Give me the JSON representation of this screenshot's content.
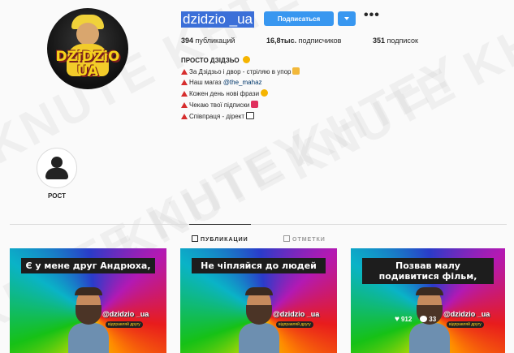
{
  "profile": {
    "username": "dzidzio _ua",
    "follow_label": "Подписаться",
    "more_label": "•••",
    "avatar_text_line1": "DZiDZiO",
    "avatar_text_line2": "UA",
    "stats": {
      "posts_count": "394",
      "posts_label": "публикаций",
      "followers_count": "16,8тыс.",
      "followers_label": "подписчиков",
      "following_count": "351",
      "following_label": "подписок"
    },
    "full_name": "ПРОСТО ДЗІДЗЬО",
    "bio_lines": [
      "За Дзідзьо і двор - стріляю в упор",
      "Наш магаз ",
      "Кожен день нові фрази",
      "Чекаю твої підписки",
      "Співпраця - дірект"
    ],
    "bio_link": "@the_mahaz"
  },
  "highlights": [
    {
      "label": "РОСТ",
      "icon": "person-icon"
    }
  ],
  "tabs": [
    {
      "label": "ПУБЛИКАЦИИ",
      "active": true
    },
    {
      "label": "ОТМЕТКИ",
      "active": false
    }
  ],
  "posts": [
    {
      "caption": "Є у мене друг Андрюха,",
      "handle": "@dzidzio _ua",
      "sub": "відправляй другу"
    },
    {
      "caption": "Не чіпляйся до людей",
      "handle": "@dzidzio _ua",
      "sub": "відправляй другу"
    },
    {
      "caption": "Позвав малу подивитися фільм,",
      "handle": "@dzidzio _ua",
      "sub": "відправляй другу",
      "likes": "912",
      "comments": "33"
    }
  ],
  "watermark": "KNUTE KHTEY",
  "colors": {
    "accent": "#3897f0",
    "selection": "#3b6fd8",
    "bio_marker": "#d62d2d"
  }
}
